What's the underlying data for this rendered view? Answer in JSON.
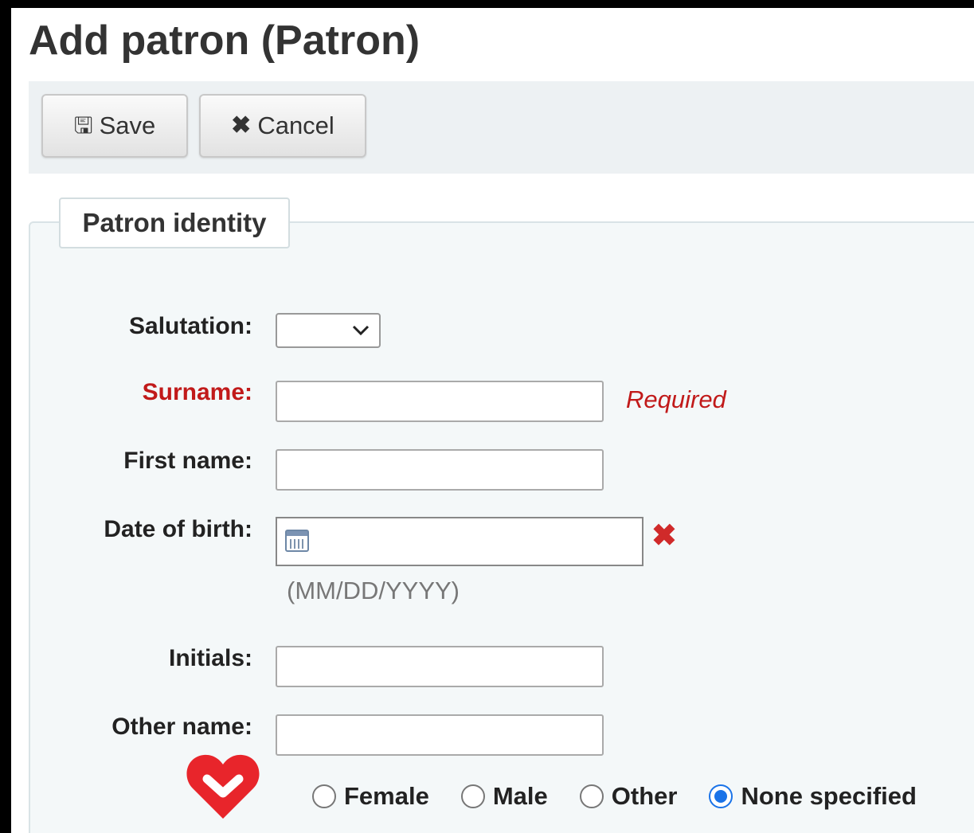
{
  "page": {
    "title": "Add patron (Patron)"
  },
  "toolbar": {
    "save_label": "Save",
    "save_icon": "floppy-disk-icon",
    "cancel_label": "Cancel",
    "cancel_icon": "x-icon"
  },
  "section": {
    "legend": "Patron identity"
  },
  "form": {
    "salutation": {
      "label": "Salutation:",
      "value": ""
    },
    "surname": {
      "label": "Surname:",
      "value": "",
      "required_note": "Required"
    },
    "first_name": {
      "label": "First name:",
      "value": ""
    },
    "date_of_birth": {
      "label": "Date of birth:",
      "value": "",
      "hint": "(MM/DD/YYYY)"
    },
    "initials": {
      "label": "Initials:",
      "value": ""
    },
    "other_name": {
      "label": "Other name:",
      "value": ""
    },
    "gender": {
      "options": [
        "Female",
        "Male",
        "Other",
        "None specified"
      ],
      "selected": "None specified"
    }
  },
  "colors": {
    "required": "#c11a1a",
    "radio_selected": "#1a73e8",
    "heart": "#e8252b",
    "toolbar_bg": "#edf1f3"
  }
}
